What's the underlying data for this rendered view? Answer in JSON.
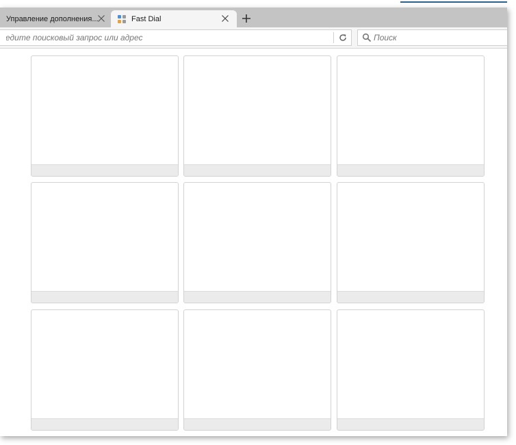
{
  "tabs": [
    {
      "title": "Управление дополнения...",
      "active": false
    },
    {
      "title": "Fast Dial",
      "active": true
    }
  ],
  "navbar": {
    "address_placeholder": "Введите поисковый запрос или адрес",
    "search_placeholder": "Поиск"
  },
  "speed_dial": {
    "columns": 3,
    "rows": 3,
    "tiles": [
      {
        "title": ""
      },
      {
        "title": ""
      },
      {
        "title": ""
      },
      {
        "title": ""
      },
      {
        "title": ""
      },
      {
        "title": ""
      },
      {
        "title": ""
      },
      {
        "title": ""
      },
      {
        "title": ""
      }
    ]
  },
  "colors": {
    "tabstrip": "#c4c4c4",
    "toolbar": "#f5f5f5",
    "tile_caption": "#ebebeb",
    "accent_line": "#2b5f8f"
  }
}
